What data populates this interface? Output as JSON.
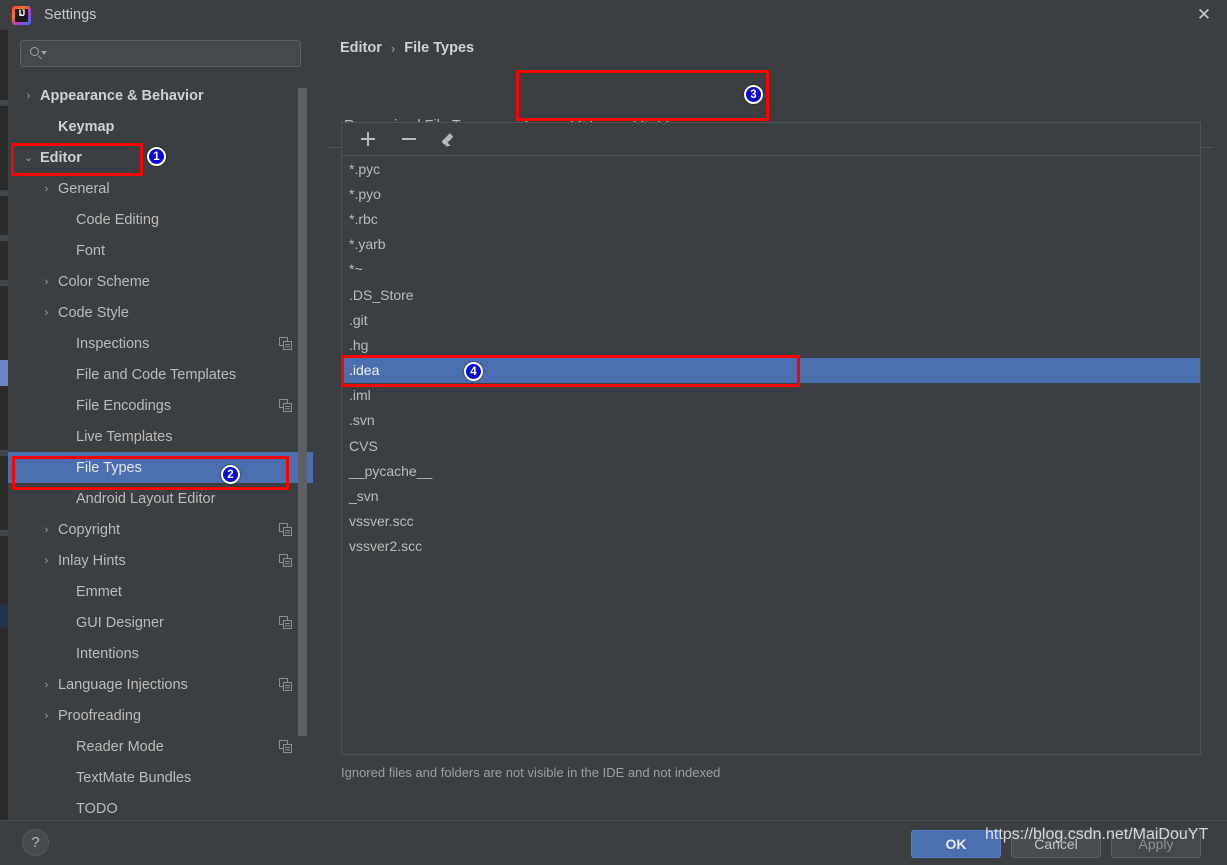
{
  "window": {
    "title": "Settings",
    "logo_icon": "intellij-idea-icon",
    "close_icon": "close-icon"
  },
  "sidebar": {
    "search": {
      "placeholder": "",
      "value": "",
      "icon": "search-icon"
    },
    "items": [
      {
        "label": "Appearance & Behavior",
        "chevron": "›",
        "bold": true,
        "indent": 0,
        "copy": false,
        "selected": false
      },
      {
        "label": "Keymap",
        "chevron": "",
        "bold": true,
        "indent": 1,
        "copy": false,
        "selected": false
      },
      {
        "label": "Editor",
        "chevron": "⌄",
        "bold": true,
        "indent": 0,
        "copy": false,
        "selected": false
      },
      {
        "label": "General",
        "chevron": "›",
        "bold": false,
        "indent": 1,
        "copy": false,
        "selected": false
      },
      {
        "label": "Code Editing",
        "chevron": "",
        "bold": false,
        "indent": 2,
        "copy": false,
        "selected": false
      },
      {
        "label": "Font",
        "chevron": "",
        "bold": false,
        "indent": 2,
        "copy": false,
        "selected": false
      },
      {
        "label": "Color Scheme",
        "chevron": "›",
        "bold": false,
        "indent": 1,
        "copy": false,
        "selected": false
      },
      {
        "label": "Code Style",
        "chevron": "›",
        "bold": false,
        "indent": 1,
        "copy": false,
        "selected": false
      },
      {
        "label": "Inspections",
        "chevron": "",
        "bold": false,
        "indent": 2,
        "copy": true,
        "selected": false
      },
      {
        "label": "File and Code Templates",
        "chevron": "",
        "bold": false,
        "indent": 2,
        "copy": false,
        "selected": false
      },
      {
        "label": "File Encodings",
        "chevron": "",
        "bold": false,
        "indent": 2,
        "copy": true,
        "selected": false
      },
      {
        "label": "Live Templates",
        "chevron": "",
        "bold": false,
        "indent": 2,
        "copy": false,
        "selected": false
      },
      {
        "label": "File Types",
        "chevron": "",
        "bold": false,
        "indent": 2,
        "copy": false,
        "selected": true
      },
      {
        "label": "Android Layout Editor",
        "chevron": "",
        "bold": false,
        "indent": 2,
        "copy": false,
        "selected": false
      },
      {
        "label": "Copyright",
        "chevron": "›",
        "bold": false,
        "indent": 1,
        "copy": true,
        "selected": false
      },
      {
        "label": "Inlay Hints",
        "chevron": "›",
        "bold": false,
        "indent": 1,
        "copy": true,
        "selected": false
      },
      {
        "label": "Emmet",
        "chevron": "",
        "bold": false,
        "indent": 2,
        "copy": false,
        "selected": false
      },
      {
        "label": "GUI Designer",
        "chevron": "",
        "bold": false,
        "indent": 2,
        "copy": true,
        "selected": false
      },
      {
        "label": "Intentions",
        "chevron": "",
        "bold": false,
        "indent": 2,
        "copy": false,
        "selected": false
      },
      {
        "label": "Language Injections",
        "chevron": "›",
        "bold": false,
        "indent": 1,
        "copy": true,
        "selected": false
      },
      {
        "label": "Proofreading",
        "chevron": "›",
        "bold": false,
        "indent": 1,
        "copy": false,
        "selected": false
      },
      {
        "label": "Reader Mode",
        "chevron": "",
        "bold": false,
        "indent": 2,
        "copy": true,
        "selected": false
      },
      {
        "label": "TextMate Bundles",
        "chevron": "",
        "bold": false,
        "indent": 2,
        "copy": false,
        "selected": false
      },
      {
        "label": "TODO",
        "chevron": "",
        "bold": false,
        "indent": 2,
        "copy": false,
        "selected": false
      }
    ]
  },
  "main": {
    "breadcrumb": {
      "parent": "Editor",
      "separator": "›",
      "current": "File Types"
    },
    "tabs": [
      {
        "label": "Recognized File Types",
        "active": false
      },
      {
        "label": "Ignored Files and Folders",
        "active": true
      }
    ],
    "toolbar": [
      {
        "name": "add-button",
        "icon": "plus-icon"
      },
      {
        "name": "remove-button",
        "icon": "minus-icon"
      },
      {
        "name": "edit-button",
        "icon": "pencil-icon"
      }
    ],
    "list_items": [
      {
        "value": "*.pyc",
        "selected": false
      },
      {
        "value": "*.pyo",
        "selected": false
      },
      {
        "value": "*.rbc",
        "selected": false
      },
      {
        "value": "*.yarb",
        "selected": false
      },
      {
        "value": "*~",
        "selected": false
      },
      {
        "value": ".DS_Store",
        "selected": false
      },
      {
        "value": ".git",
        "selected": false
      },
      {
        "value": ".hg",
        "selected": false
      },
      {
        "value": ".idea",
        "selected": true
      },
      {
        "value": ".iml",
        "selected": false
      },
      {
        "value": ".svn",
        "selected": false
      },
      {
        "value": "CVS",
        "selected": false
      },
      {
        "value": "__pycache__",
        "selected": false
      },
      {
        "value": "_svn",
        "selected": false
      },
      {
        "value": "vssver.scc",
        "selected": false
      },
      {
        "value": "vssver2.scc",
        "selected": false
      }
    ],
    "hint": "Ignored files and folders are not visible in the IDE and not indexed"
  },
  "footer": {
    "help_label": "?",
    "ok_label": "OK",
    "cancel_label": "Cancel",
    "apply_label": "Apply"
  },
  "annotations": {
    "badge_1": "1",
    "badge_2": "2",
    "badge_3": "3",
    "badge_4": "4",
    "box_color": "#fe0000",
    "badge_color": "#0a0ad0"
  },
  "watermark": {
    "text": "https://blog.csdn.net/MaiDouYT"
  }
}
